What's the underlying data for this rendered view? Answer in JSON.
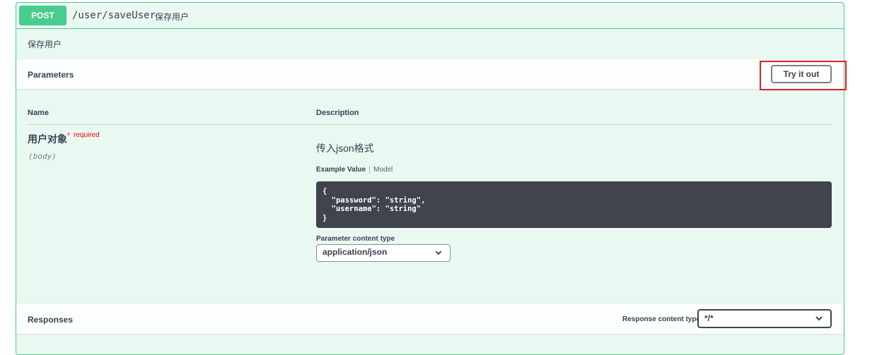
{
  "operation": {
    "method": "POST",
    "path": "/user/saveUser",
    "summary": "保存用户",
    "description": "保存用户"
  },
  "parameters_section": {
    "title": "Parameters",
    "try_it_out_label": "Try it out",
    "columns": {
      "name": "Name",
      "description": "Description"
    },
    "param": {
      "name": "用户对象",
      "required_star": "*",
      "required_label": "required",
      "in": "(body)",
      "description": "传入json格式"
    },
    "example_tabs": {
      "active": "Example Value",
      "other": "Model"
    },
    "example_code": "{\n  \"password\": \"string\",\n  \"username\": \"string\"\n}",
    "content_type_label": "Parameter content type",
    "content_type_value": "application/json"
  },
  "responses_section": {
    "title": "Responses",
    "content_type_label": "Response content type",
    "content_type_value": "*/*"
  },
  "colors": {
    "post_green": "#49cc90",
    "code_bg": "#41444e",
    "highlight_red": "#e02020",
    "required_red": "#ff0000"
  },
  "icons": {
    "select_chevron": "chevron-down-icon"
  }
}
